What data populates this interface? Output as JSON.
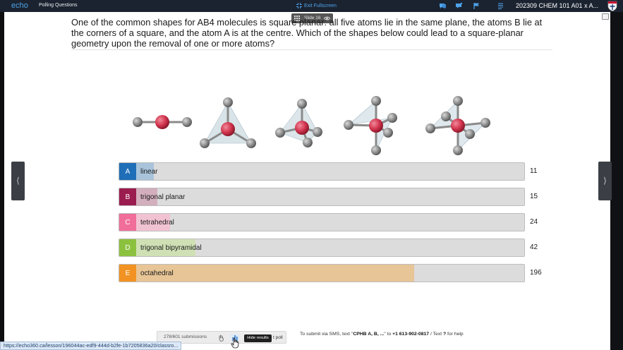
{
  "header": {
    "brand": "echo",
    "subtitle": "Polling Questions",
    "exit_label": "Exit Fullscreen",
    "course": "202309 CHEM 101 A01 x A..."
  },
  "slide_badge": {
    "label": "Slide 16"
  },
  "question": {
    "text": "One of the common shapes for AB4 molecules is square planar: all five atoms lie in the same plane, the atoms B lie at the corners of a square, and the atom A is at the centre. Which of the shapes below could lead to a square-planar geometry upon the removal of one or more atoms?"
  },
  "molecules": [
    "linear",
    "trigonal planar",
    "tetrahedral",
    "trigonal bipyramidal",
    "octahedral"
  ],
  "answers": [
    {
      "letter": "A",
      "label": "linear",
      "count": "11",
      "fraction": 0.0436,
      "color": "#1e6eb8",
      "fill": "#a8c3da"
    },
    {
      "letter": "B",
      "label": "trigonal planar",
      "count": "15",
      "fraction": 0.0524,
      "color": "#9b1c4f",
      "fill": "#d3aebd"
    },
    {
      "letter": "C",
      "label": "tetrahedral",
      "count": "24",
      "fraction": 0.0837,
      "color": "#f06e99",
      "fill": "#f1c3d2"
    },
    {
      "letter": "D",
      "label": "trigonal bipyramidal",
      "count": "42",
      "fraction": 0.1466,
      "color": "#8cc13f",
      "fill": "#cfe1b4"
    },
    {
      "letter": "E",
      "label": "octahedral",
      "count": "196",
      "fraction": 0.6841,
      "color": "#f29222",
      "fill": "#e7c596"
    }
  ],
  "controls": {
    "submissions": "278/601 submissions",
    "tooltip": "Hide results",
    "poll_label": "t poll",
    "sms_prefix": "To submit via SMS, text \"",
    "sms_code": "CPHB A, B, ...",
    "sms_mid": "\" to ",
    "sms_number": "+1 613-902-0817",
    "sms_mid2": " / Text ",
    "sms_q": "?",
    "sms_suffix": " for help"
  },
  "status_url": "https://echo360.ca/lesson/196044ac-edf9-444d-b2fe-1b7205836a20/classro..."
}
